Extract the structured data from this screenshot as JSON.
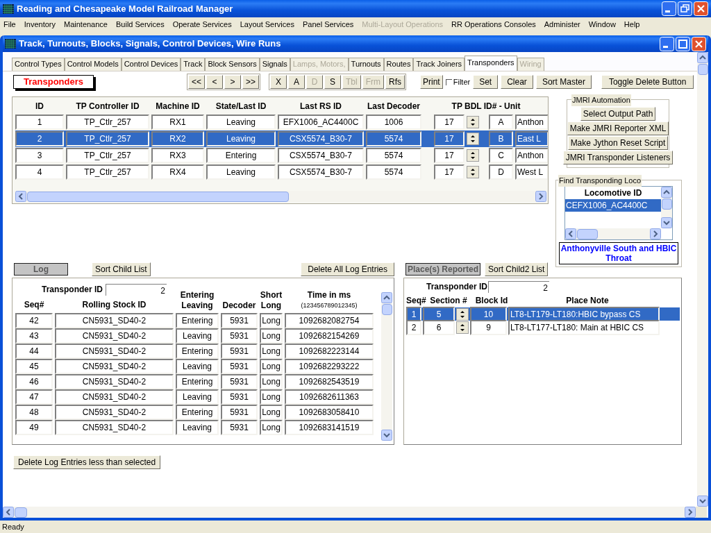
{
  "window": {
    "title": "Reading and Chesapeake Model Railroad Manager"
  },
  "menu": [
    {
      "label": "File",
      "disabled": false
    },
    {
      "label": "Inventory",
      "disabled": false
    },
    {
      "label": "Maintenance",
      "disabled": false
    },
    {
      "label": "Build Services",
      "disabled": false
    },
    {
      "label": "Operate Services",
      "disabled": false
    },
    {
      "label": "Layout Services",
      "disabled": false
    },
    {
      "label": "Panel Services",
      "disabled": false
    },
    {
      "label": "Multi-Layout Operations",
      "disabled": true
    },
    {
      "label": "RR Operations Consoles",
      "disabled": false
    },
    {
      "label": "Administer",
      "disabled": false
    },
    {
      "label": "Window",
      "disabled": false
    },
    {
      "label": "Help",
      "disabled": false
    }
  ],
  "child_window": {
    "title": "Track, Turnouts, Blocks, Signals, Control Devices, Wire Runs"
  },
  "tabs": [
    {
      "label": "Control Types",
      "selected": false,
      "disabled": false
    },
    {
      "label": "Control Models",
      "selected": false,
      "disabled": false
    },
    {
      "label": "Control Devices",
      "selected": false,
      "disabled": false
    },
    {
      "label": "Track",
      "selected": false,
      "disabled": false
    },
    {
      "label": "Block Sensors",
      "selected": false,
      "disabled": false
    },
    {
      "label": "Signals",
      "selected": false,
      "disabled": false
    },
    {
      "label": "Lamps, Motors,",
      "selected": false,
      "disabled": true
    },
    {
      "label": "Turnouts",
      "selected": false,
      "disabled": false
    },
    {
      "label": "Routes",
      "selected": false,
      "disabled": false
    },
    {
      "label": "Track Joiners",
      "selected": false,
      "disabled": false
    },
    {
      "label": "Transponders",
      "selected": true,
      "disabled": false
    },
    {
      "label": "Wiring",
      "selected": false,
      "disabled": true
    }
  ],
  "master": {
    "heading": "Transponders",
    "nav_groups": [
      [
        {
          "label": "<<",
          "disabled": false
        },
        {
          "label": "<",
          "disabled": false
        },
        {
          "label": ">",
          "disabled": false
        },
        {
          "label": ">>",
          "disabled": false
        }
      ],
      [
        {
          "label": "X",
          "disabled": false
        },
        {
          "label": "A",
          "disabled": false
        },
        {
          "label": "D",
          "disabled": true
        },
        {
          "label": "S",
          "disabled": false
        },
        {
          "label": "Tbl",
          "disabled": true
        },
        {
          "label": "Frm",
          "disabled": true
        },
        {
          "label": "Rfs",
          "disabled": false
        }
      ]
    ],
    "print_button": "Print",
    "filter": {
      "label": "Filter",
      "checked": false
    },
    "set_button": "Set",
    "clear_button": "Clear",
    "sort_button": "Sort Master",
    "toggle_delete_button": "Toggle Delete Button"
  },
  "grid": {
    "columns": [
      "ID",
      "TP Controller ID",
      "Machine ID",
      "State/Last ID",
      "Last RS ID",
      "Last Decoder",
      "TP BDL ID# - Unit"
    ],
    "rows": [
      {
        "id": "1",
        "controller": "TP_Ctlr_257",
        "machine": "RX1",
        "state": "Leaving",
        "last_rs": "EFX1006_AC4400C",
        "decoder": "1006",
        "bdl": "17",
        "unit": "A",
        "column_9": "Anthon",
        "selected": false
      },
      {
        "id": "2",
        "controller": "TP_Ctlr_257",
        "machine": "RX2",
        "state": "Leaving",
        "last_rs": "CSX5574_B30-7",
        "decoder": "5574",
        "bdl": "17",
        "unit": "B",
        "column_9": "East L",
        "selected": true
      },
      {
        "id": "3",
        "controller": "TP_Ctlr_257",
        "machine": "RX3",
        "state": "Entering",
        "last_rs": "CSX5574_B30-7",
        "decoder": "5574",
        "bdl": "17",
        "unit": "C",
        "column_9": "Anthon",
        "selected": false
      },
      {
        "id": "4",
        "controller": "TP_Ctlr_257",
        "machine": "RX4",
        "state": "Leaving",
        "last_rs": "CSX5574_B30-7",
        "decoder": "5574",
        "bdl": "17",
        "unit": "D",
        "column_9": "West L",
        "selected": false
      }
    ]
  },
  "jmri": {
    "title": "JMRI Automation",
    "buttons": [
      "Select Output Path",
      "Make JMRI Reporter XML",
      "Make Jython Reset Script",
      "JMRI Transponder Listeners"
    ]
  },
  "find_loco": {
    "title": "Find Transponding Loco",
    "column": "Locomotive ID",
    "items": [
      {
        "label": "CEFX1006_AC4400C",
        "selected": true
      }
    ],
    "place": "Anthonyville South and HBIC Throat"
  },
  "log": {
    "heading": "Log",
    "sort_button": "Sort Child List",
    "delete_all_button": "Delete All Log Entries",
    "transponder_label": "Transponder ID",
    "transponder_value": "2",
    "columns": [
      {
        "label": "Seq#"
      },
      {
        "label": "Rolling Stock ID"
      },
      {
        "lines": [
          "Entering",
          "Leaving"
        ]
      },
      {
        "label": "Decoder"
      },
      {
        "lines": [
          "Short",
          "Long"
        ]
      },
      {
        "label": "Time in ms",
        "note": "(123456789012345)"
      }
    ],
    "rows": [
      {
        "seq": "42",
        "stock": "CN5931_SD40-2",
        "direction": "Entering",
        "decoder": "5931",
        "length": "Long",
        "time": "1092682082754"
      },
      {
        "seq": "43",
        "stock": "CN5931_SD40-2",
        "direction": "Leaving",
        "decoder": "5931",
        "length": "Long",
        "time": "1092682154269"
      },
      {
        "seq": "44",
        "stock": "CN5931_SD40-2",
        "direction": "Entering",
        "decoder": "5931",
        "length": "Long",
        "time": "1092682223144"
      },
      {
        "seq": "45",
        "stock": "CN5931_SD40-2",
        "direction": "Leaving",
        "decoder": "5931",
        "length": "Long",
        "time": "1092682293222"
      },
      {
        "seq": "46",
        "stock": "CN5931_SD40-2",
        "direction": "Entering",
        "decoder": "5931",
        "length": "Long",
        "time": "1092682543519"
      },
      {
        "seq": "47",
        "stock": "CN5931_SD40-2",
        "direction": "Leaving",
        "decoder": "5931",
        "length": "Long",
        "time": "1092682611363"
      },
      {
        "seq": "48",
        "stock": "CN5931_SD40-2",
        "direction": "Entering",
        "decoder": "5931",
        "length": "Long",
        "time": "1092683058410"
      },
      {
        "seq": "49",
        "stock": "CN5931_SD40-2",
        "direction": "Leaving",
        "decoder": "5931",
        "length": "Long",
        "time": "1092683141519"
      }
    ],
    "delete_less_button": "Delete Log Entries less than selected"
  },
  "places": {
    "heading": "Place(s) Reported",
    "sort_button": "Sort Child2 List",
    "transponder_label": "Transponder ID",
    "transponder_value": "2",
    "columns": [
      "Seq#",
      "Section #",
      "Block Id",
      "Place Note"
    ],
    "rows": [
      {
        "seq": "1",
        "section": "5",
        "block": "10",
        "note": "LT8-LT179-LT180:HBIC bypass CS",
        "selected": true
      },
      {
        "seq": "2",
        "section": "6",
        "block": "9",
        "note": "LT8-LT177-LT180: Main at HBIC CS",
        "selected": false
      }
    ]
  },
  "status_bar": "Ready"
}
